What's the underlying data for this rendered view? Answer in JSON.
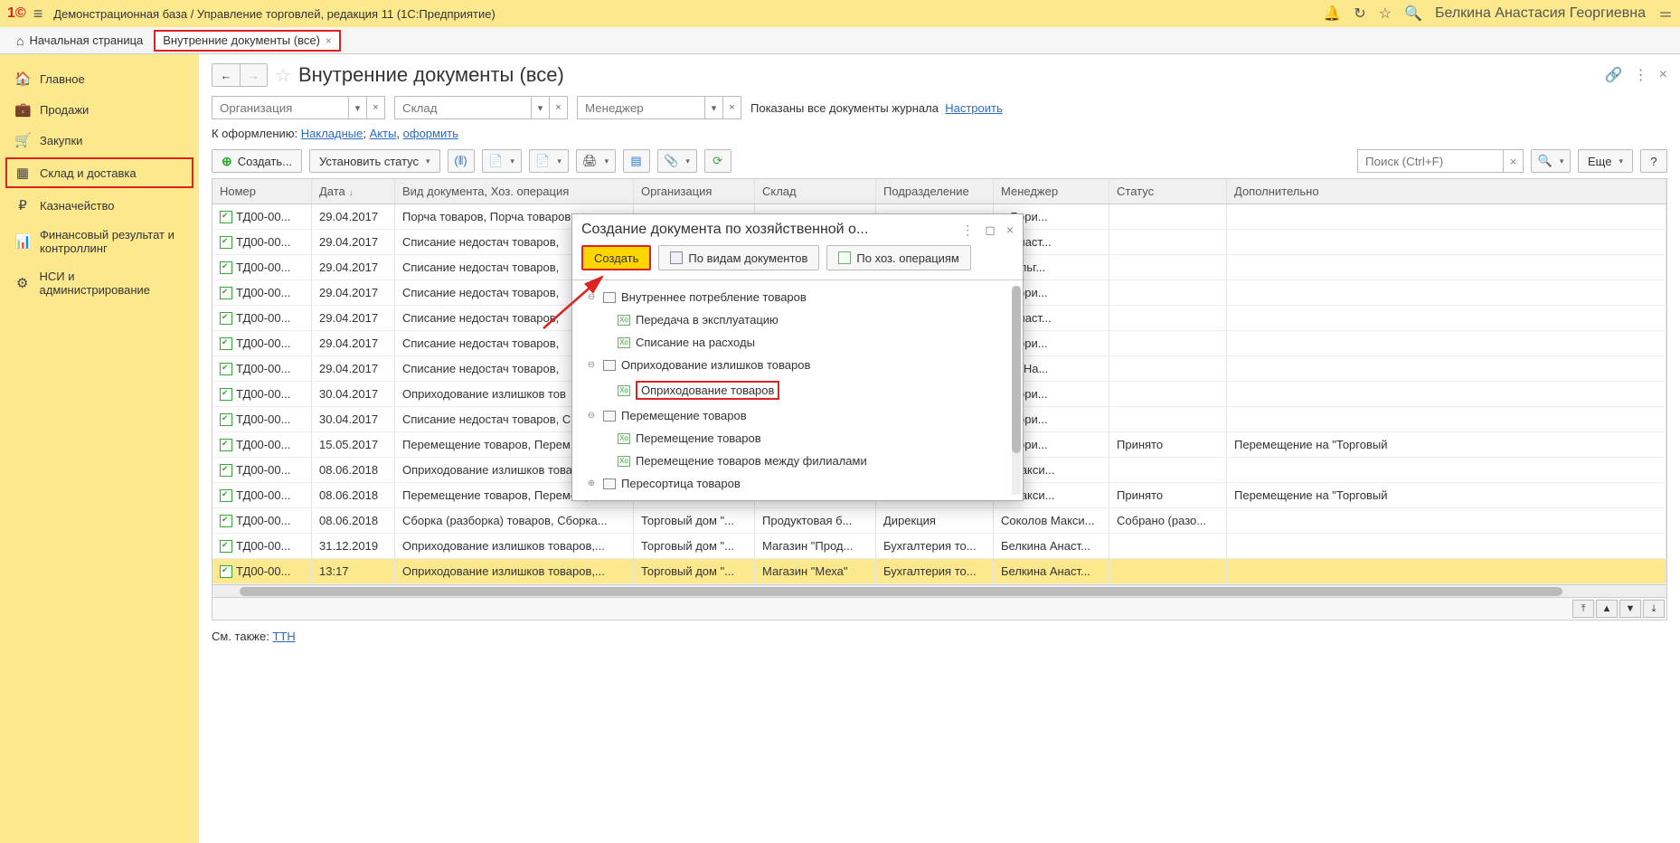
{
  "app": {
    "title": "Демонстрационная база / Управление торговлей, редакция 11  (1С:Предприятие)",
    "user": "Белкина Анастасия Георгиевна"
  },
  "tabs": {
    "home": "Начальная страница",
    "active": "Внутренние документы (все)"
  },
  "sidebar": [
    {
      "icon": "🏠",
      "label": "Главное"
    },
    {
      "icon": "💼",
      "label": "Продажи"
    },
    {
      "icon": "🛒",
      "label": "Закупки"
    },
    {
      "icon": "▦",
      "label": "Склад и доставка",
      "highlighted": true
    },
    {
      "icon": "₽",
      "label": "Казначейство"
    },
    {
      "icon": "📊",
      "label": "Финансовый результат и контроллинг"
    },
    {
      "icon": "⚙",
      "label": "НСИ и администрирование"
    }
  ],
  "page": {
    "title": "Внутренние документы (все)"
  },
  "filters": {
    "org_placeholder": "Организация",
    "sklad_placeholder": "Склад",
    "mgr_placeholder": "Менеджер",
    "shown_text": "Показаны все документы журнала",
    "configure": "Настроить"
  },
  "oformlenie": {
    "prefix": "К оформлению:",
    "link1": "Накладные",
    "link2": "Акты",
    "link3": "оформить"
  },
  "toolbar": {
    "create": "Создать...",
    "set_status": "Установить статус",
    "search_placeholder": "Поиск (Ctrl+F)",
    "more": "Еще"
  },
  "grid": {
    "headers": {
      "num": "Номер",
      "date": "Дата",
      "vid": "Вид документа, Хоз. операция",
      "org": "Организация",
      "sklad": "Склад",
      "podr": "Подразделение",
      "mgr": "Менеджер",
      "status": "Статус",
      "dop": "Дополнительно"
    },
    "rows": [
      {
        "num": "ТД00-00...",
        "date": "29.04.2017",
        "vid": "Порча товаров, Порча товаров",
        "org": "",
        "sklad": "",
        "podr": "",
        "mgr": "в Бори...",
        "status": "",
        "dop": ""
      },
      {
        "num": "ТД00-00...",
        "date": "29.04.2017",
        "vid": "Списание недостач товаров,",
        "org": "",
        "sklad": "",
        "podr": "",
        "mgr": "1 Анаст...",
        "status": "",
        "dop": ""
      },
      {
        "num": "ТД00-00...",
        "date": "29.04.2017",
        "vid": "Списание недостач товаров,",
        "org": "",
        "sklad": "",
        "podr": "",
        "mgr": "а Ольг...",
        "status": "",
        "dop": ""
      },
      {
        "num": "ТД00-00...",
        "date": "29.04.2017",
        "vid": "Списание недостач товаров,",
        "org": "",
        "sklad": "",
        "podr": "",
        "mgr": "в Бори...",
        "status": "",
        "dop": ""
      },
      {
        "num": "ТД00-00...",
        "date": "29.04.2017",
        "vid": "Списание недостач товаров,",
        "org": "",
        "sklad": "",
        "podr": "",
        "mgr": "1 Анаст...",
        "status": "",
        "dop": ""
      },
      {
        "num": "ТД00-00...",
        "date": "29.04.2017",
        "vid": "Списание недостач товаров,",
        "org": "",
        "sklad": "",
        "podr": "",
        "mgr": "в Бори...",
        "status": "",
        "dop": ""
      },
      {
        "num": "ТД00-00...",
        "date": "29.04.2017",
        "vid": "Списание недостач товаров,",
        "org": "",
        "sklad": "",
        "podr": "",
        "mgr": "ова На...",
        "status": "",
        "dop": ""
      },
      {
        "num": "ТД00-00...",
        "date": "30.04.2017",
        "vid": "Оприходование излишков тов",
        "org": "",
        "sklad": "",
        "podr": "",
        "mgr": "в Бори...",
        "status": "",
        "dop": ""
      },
      {
        "num": "ТД00-00...",
        "date": "30.04.2017",
        "vid": "Списание недостач товаров, С",
        "org": "",
        "sklad": "",
        "podr": "",
        "mgr": "в Бори...",
        "status": "",
        "dop": ""
      },
      {
        "num": "ТД00-00...",
        "date": "15.05.2017",
        "vid": "Перемещение товаров, Перем",
        "org": "",
        "sklad": "",
        "podr": "",
        "mgr": "в Бори...",
        "status": "Принято",
        "dop": "Перемещение на \"Торговый"
      },
      {
        "num": "ТД00-00...",
        "date": "08.06.2018",
        "vid": "Оприходование излишков товаров,",
        "org": "",
        "sklad": "",
        "podr": "",
        "mgr": "1 Макси...",
        "status": "",
        "dop": ""
      },
      {
        "num": "ТД00-00...",
        "date": "08.06.2018",
        "vid": "Перемещение товаров, Перемеще...",
        "org": "",
        "sklad": "",
        "podr": "",
        "mgr": "1 Макси...",
        "status": "Принято",
        "dop": "Перемещение на \"Торговый"
      },
      {
        "num": "ТД00-00...",
        "date": "08.06.2018",
        "vid": "Сборка (разборка) товаров, Сборка...",
        "org": "Торговый дом \"...",
        "sklad": "Продуктовая б...",
        "podr": "Дирекция",
        "mgr": "Соколов Макси...",
        "status": "Собрано (разо...",
        "dop": ""
      },
      {
        "num": "ТД00-00...",
        "date": "31.12.2019",
        "vid": "Оприходование излишков товаров,...",
        "org": "Торговый дом \"...",
        "sklad": "Магазин \"Прод...",
        "podr": "Бухгалтерия то...",
        "mgr": "Белкина Анаст...",
        "status": "",
        "dop": ""
      },
      {
        "num": "ТД00-00...",
        "date": "13:17",
        "vid": "Оприходование излишков товаров,...",
        "org": "Торговый дом \"...",
        "sklad": "Магазин \"Меха\"",
        "podr": "Бухгалтерия то...",
        "mgr": "Белкина Анаст...",
        "status": "",
        "dop": "",
        "selected": true
      }
    ]
  },
  "footer": {
    "prefix": "См. также:",
    "link": "ТТН"
  },
  "dialog": {
    "title": "Создание документа по хозяйственной о...",
    "create": "Создать",
    "by_types": "По видам документов",
    "by_ops": "По хоз. операциям",
    "tree": [
      {
        "level": 1,
        "expander": "⊖",
        "type": "folder",
        "label": "Внутреннее потребление товаров"
      },
      {
        "level": 2,
        "expander": "",
        "type": "leaf",
        "label": "Передача в эксплуатацию"
      },
      {
        "level": 2,
        "expander": "",
        "type": "leaf",
        "label": "Списание на расходы"
      },
      {
        "level": 1,
        "expander": "⊖",
        "type": "folder",
        "label": "Оприходование излишков товаров"
      },
      {
        "level": 2,
        "expander": "",
        "type": "leaf",
        "label": "Оприходование товаров",
        "highlighted": true
      },
      {
        "level": 1,
        "expander": "⊖",
        "type": "folder",
        "label": "Перемещение товаров"
      },
      {
        "level": 2,
        "expander": "",
        "type": "leaf",
        "label": "Перемещение товаров"
      },
      {
        "level": 2,
        "expander": "",
        "type": "leaf",
        "label": "Перемещение товаров между филиалами"
      },
      {
        "level": 1,
        "expander": "⊕",
        "type": "folder",
        "label": "Пересортица товаров"
      }
    ]
  }
}
